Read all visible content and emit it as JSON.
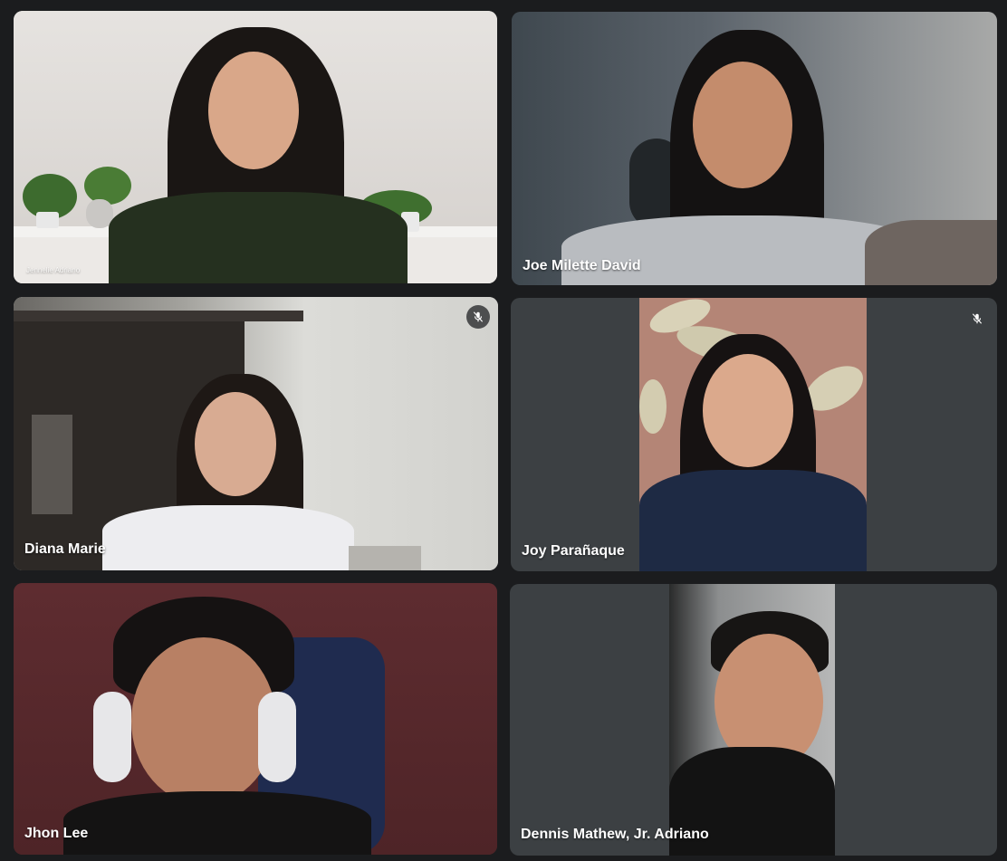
{
  "participants": [
    {
      "name": "Jennelie Adriano",
      "muted": false,
      "bg": "#d9d6d3"
    },
    {
      "name": "Joe Milette David",
      "muted": false,
      "bg": "#4a525a"
    },
    {
      "name": "Diana Marie",
      "muted": true,
      "bg": "#cfcfcb"
    },
    {
      "name": "Joy Parañaque",
      "muted": true,
      "bg": "#3c4043"
    },
    {
      "name": "Jhon Lee",
      "muted": false,
      "bg": "#5a2a2c"
    },
    {
      "name": "Dennis Mathew, Jr. Adriano",
      "muted": false,
      "bg": "#3c4043"
    }
  ],
  "icons": {
    "mute": "mic-off-icon"
  }
}
